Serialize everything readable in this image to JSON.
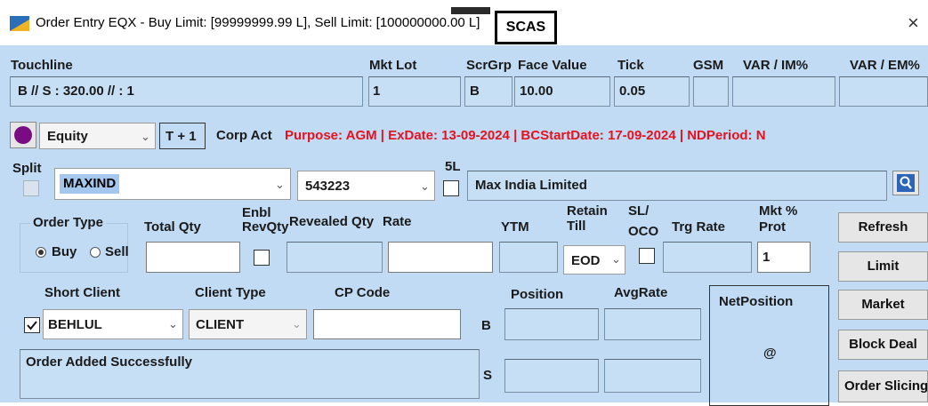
{
  "window": {
    "title": "Order Entry EQX - Buy Limit: [99999999.99 L], Sell Limit: [100000000.00 L]",
    "badge": "SCAS",
    "close": "×"
  },
  "touchline": {
    "label": "Touchline",
    "value": "B // S : 320.00 // : 1",
    "mktlot_label": "Mkt Lot",
    "mktlot": "1",
    "scrgrp_label": "ScrGrp",
    "scrgrp": "B",
    "facevalue_label": "Face Value",
    "facevalue": "10.00",
    "tick_label": "Tick",
    "tick": "0.05",
    "gsm_label": "GSM",
    "varim_label": "VAR / IM%",
    "varem_label": "VAR / EM%"
  },
  "row2": {
    "segment": "Equity",
    "settlement": "T + 1",
    "corpact_label": "Corp Act",
    "corpact_text": "Purpose: AGM  | ExDate: 13-09-2024  | BCStartDate: 17-09-2024  | NDPeriod: N",
    "indicator_color": "#7a0c83"
  },
  "row3": {
    "split_label": "Split",
    "symbol": "MAXIND",
    "code": "543223",
    "fivel_label": "5L",
    "company": "Max India Limited"
  },
  "order": {
    "order_type_label": "Order Type",
    "buy_label": "Buy",
    "sell_label": "Sell",
    "total_qty_label": "Total Qty",
    "enbl_label_1": "Enbl",
    "enbl_label_2": "RevQty",
    "revealed_qty_label": "Revealed Qty",
    "rate_label": "Rate",
    "ytm_label": "YTM",
    "retain_label_1": "Retain",
    "retain_label_2": "Till",
    "retain_value": "EOD",
    "sloco_label_1": "SL/",
    "sloco_label_2": "OCO",
    "trg_rate_label": "Trg Rate",
    "mktprot_label_1": "Mkt %",
    "mktprot_label_2": "Prot",
    "mktprot_value": "1"
  },
  "client": {
    "short_client_label": "Short Client",
    "short_client_value": "BEHLUL",
    "client_type_label": "Client Type",
    "client_type_value": "CLIENT",
    "cp_code_label": "CP Code",
    "position_label": "Position",
    "avgrate_label": "AvgRate",
    "b_label": "B",
    "s_label": "S",
    "netposition_label": "NetPosition",
    "netposition_value": "@"
  },
  "status": {
    "message": "Order Added Successfully"
  },
  "buttons": {
    "refresh": "Refresh",
    "limit": "Limit",
    "market": "Market",
    "block_deal": "Block Deal",
    "order_slicing": "Order Slicing"
  }
}
